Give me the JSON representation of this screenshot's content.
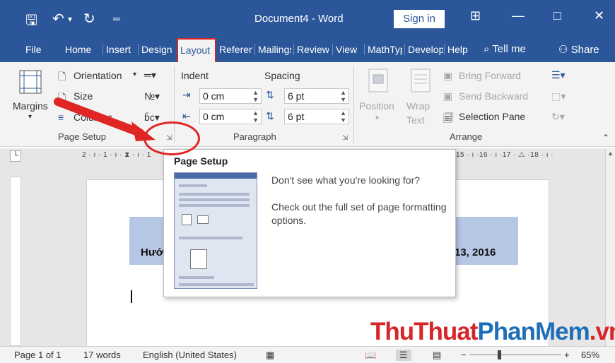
{
  "titlebar": {
    "save_icon": "save-icon",
    "undo_icon": "undo-icon",
    "redo_icon": "redo-icon",
    "customize_icon": "customize-qat-icon",
    "title": "Document4 - Word",
    "signin": "Sign in"
  },
  "tabs": {
    "file": "File",
    "home": "Home",
    "insert": "Insert",
    "design": "Design",
    "layout": "Layout",
    "references": "References",
    "mailings": "Mailings",
    "review": "Review",
    "view": "View",
    "mathtype": "MathType",
    "developer": "Developer",
    "help": "Help",
    "tellme": "Tell me",
    "share": "Share"
  },
  "ribbon": {
    "margins": "Margins",
    "orientation": "Orientation",
    "size": "Size",
    "columns": "Columns",
    "page_setup": "Page Setup",
    "indent": "Indent",
    "spacing": "Spacing",
    "indent_left": "0 cm",
    "indent_right": "0 cm",
    "spacing_before": "6 pt",
    "spacing_after": "6 pt",
    "paragraph": "Paragraph",
    "position": "Position",
    "wrap": "Wrap",
    "text": "Text",
    "bring_forward": "Bring Forward",
    "send_backward": "Send Backward",
    "selection_pane": "Selection Pane",
    "arrange": "Arrange"
  },
  "ruler": {
    "left": "2 · ı · 1 · ı · ⧗ · ı · 1",
    "right": "15 · ı ·16 · ı ·17 · ⧍ ·18 · ı ·"
  },
  "document": {
    "line_left": "Hướ",
    "line_right": "13, 2016"
  },
  "tooltip": {
    "title": "Page Setup",
    "line1": "Don't see what you're looking for?",
    "line2": "Check out the full set of page formatting options."
  },
  "watermark": {
    "part1": "ThuThuat",
    "part2": "PhanMem",
    "part3": ".vn"
  },
  "statusbar": {
    "page": "Page 1 of 1",
    "words": "17 words",
    "language": "English (United States)",
    "zoom": "65%"
  },
  "colors": {
    "title_blue": "#2b579a",
    "highlight_red": "#e02525",
    "band": "#b6c7e6"
  }
}
